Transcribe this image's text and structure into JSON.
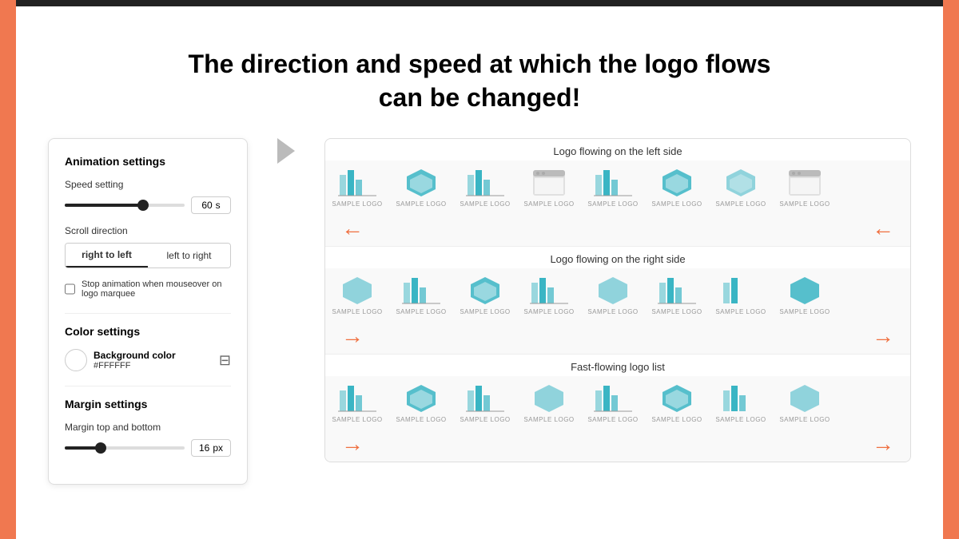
{
  "page": {
    "title_line1": "The direction and speed at which the logo flows",
    "title_line2": "can be changed!"
  },
  "settings": {
    "animation_title": "Animation settings",
    "speed_label": "Speed setting",
    "speed_value": "60",
    "speed_unit": "s",
    "scroll_direction_label": "Scroll direction",
    "btn_right_to_left": "right to left",
    "btn_left_to_right": "left to right",
    "stop_animation_label": "Stop animation when mouseover on logo marquee",
    "color_section_title": "Color settings",
    "background_color_label": "Background color",
    "background_color_value": "#FFFFFF",
    "margin_section_title": "Margin settings",
    "margin_label": "Margin top and bottom",
    "margin_value": "16",
    "margin_unit": "px"
  },
  "demo": {
    "left_label": "Logo flowing on the left side",
    "right_label": "Logo flowing on the right side",
    "fast_label": "Fast-flowing logo list"
  }
}
